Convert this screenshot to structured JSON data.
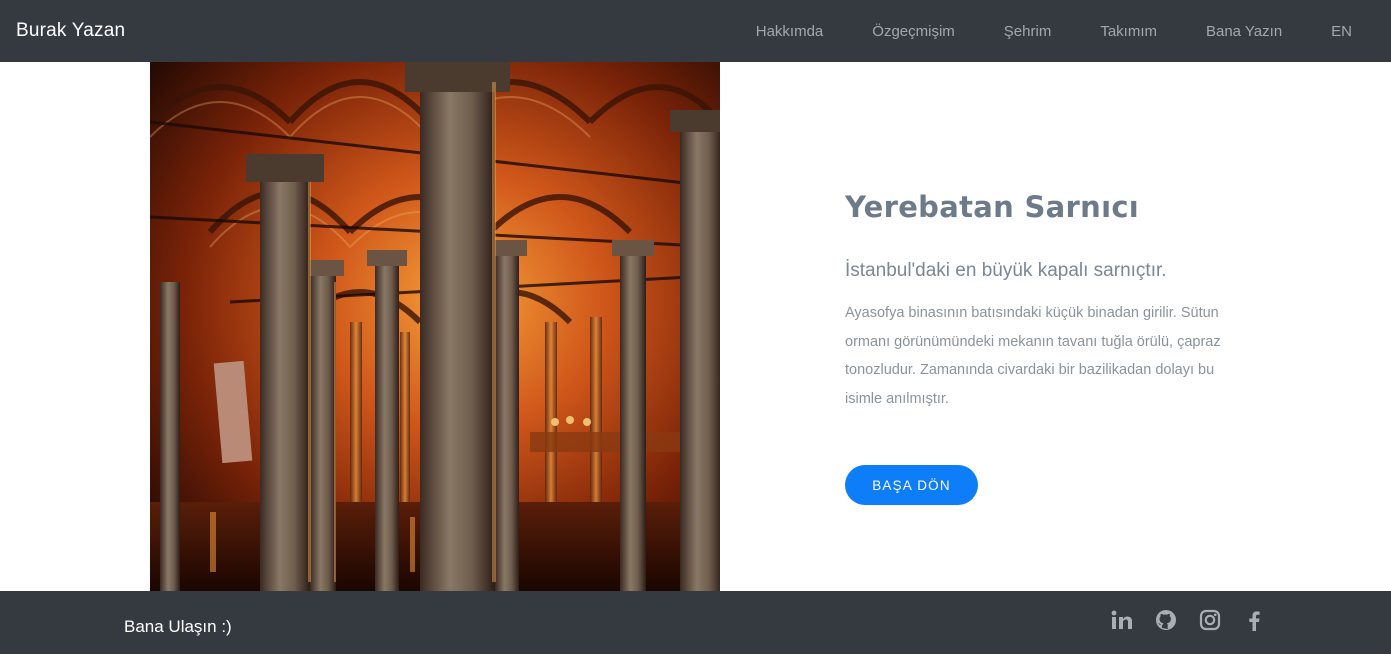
{
  "nav": {
    "brand": "Burak Yazan",
    "links": [
      "Hakkımda",
      "Özgeçmişim",
      "Şehrim",
      "Takımım",
      "Bana Yazın",
      "EN"
    ]
  },
  "section": {
    "title": "Yerebatan Sarnıcı",
    "subtitle": "İstanbul'daki en büyük kapalı sarnıçtır.",
    "description": "Ayasofya binasının batısındaki küçük binadan girilir. Sütun ormanı görünümündeki mekanın tavanı tuğla örülü, çapraz tonozludur. Zamanında civardaki bir bazilikadan dolayı bu isimle anılmıştır.",
    "button_label": "BAŞA DÖN"
  },
  "footer": {
    "contact_label": "Bana Ulaşın :)",
    "social_icons": [
      "linkedin-icon",
      "github-icon",
      "instagram-icon",
      "facebook-icon"
    ]
  },
  "colors": {
    "navbar_bg": "#343a40",
    "button_bg": "#0d7df8",
    "title": "#6c7a89"
  }
}
